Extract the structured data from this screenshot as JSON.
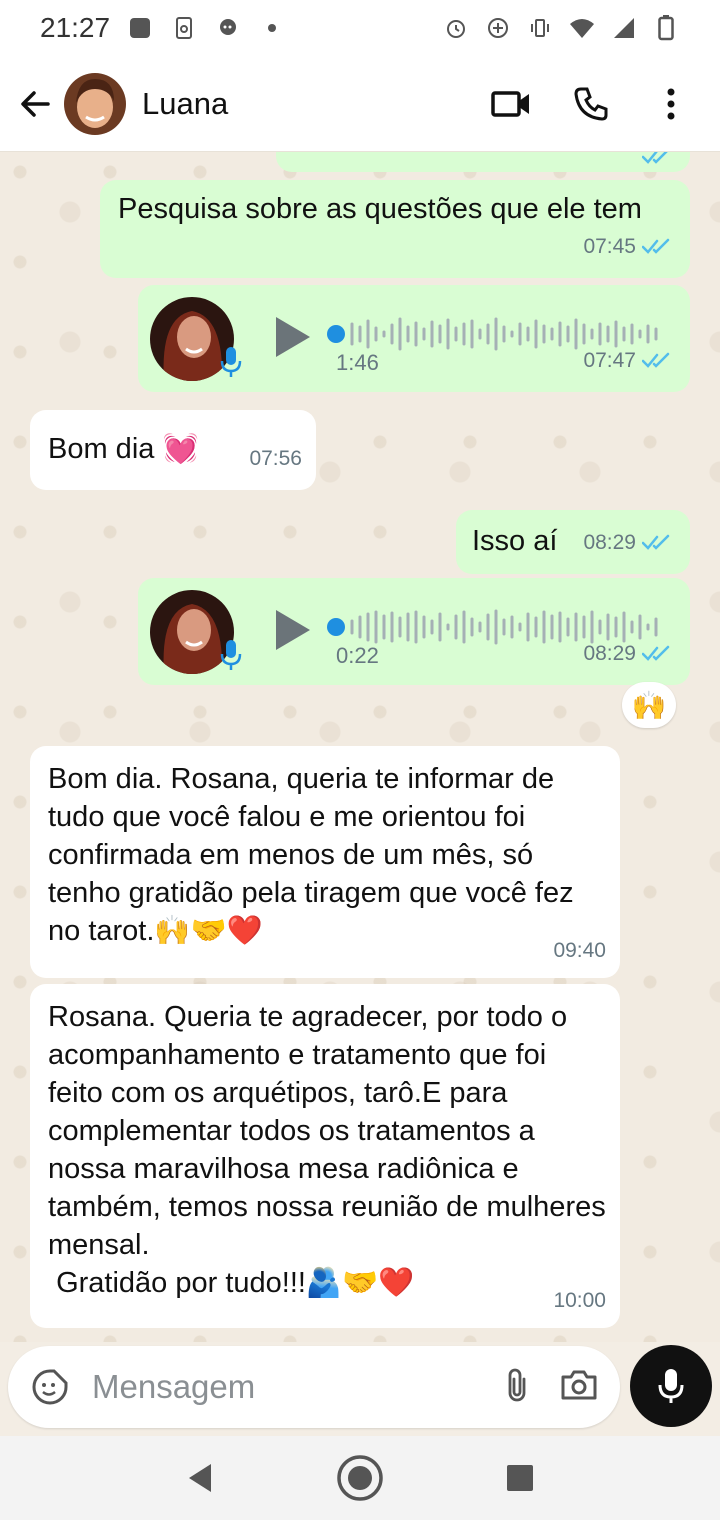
{
  "status_bar": {
    "time": "21:27"
  },
  "header": {
    "contact_name": "Luana"
  },
  "messages": [
    {
      "type": "text",
      "direction": "out",
      "text": "Pesquisa sobre as questões que ele tem",
      "time": "07:45",
      "read": true
    },
    {
      "type": "voice",
      "direction": "out",
      "duration": "1:46",
      "time": "07:47",
      "read": true
    },
    {
      "type": "text",
      "direction": "in",
      "text": "Bom dia 💓",
      "time": "07:56"
    },
    {
      "type": "text",
      "direction": "out",
      "text": "Isso aí",
      "time": "08:29",
      "read": true
    },
    {
      "type": "voice",
      "direction": "out",
      "duration": "0:22",
      "time": "08:29",
      "read": true,
      "reaction": "🙌"
    },
    {
      "type": "text",
      "direction": "in",
      "text": "Bom dia. Rosana, queria te informar de tudo que você falou e me orientou foi confirmada em menos de um mês, só tenho gratidão pela tiragem que você fez no tarot.🙌🤝❤️",
      "time": "09:40"
    },
    {
      "type": "text",
      "direction": "in",
      "text": "Rosana. Queria te agradecer, por todo o acompanhamento e tratamento que foi feito com os arquétipos, tarô.E para complementar todos os tratamentos a nossa maravilhosa mesa radiônica e também, temos nossa reunião de mulheres mensal.\n Gratidão por tudo!!!🫂🤝❤️",
      "time": "10:00"
    }
  ],
  "composer": {
    "placeholder": "Mensagem"
  },
  "colors": {
    "outgoing_bubble": "#d9fdd3",
    "incoming_bubble": "#ffffff",
    "read_ticks": "#53bdeb",
    "chat_background": "#f2ebe1"
  }
}
